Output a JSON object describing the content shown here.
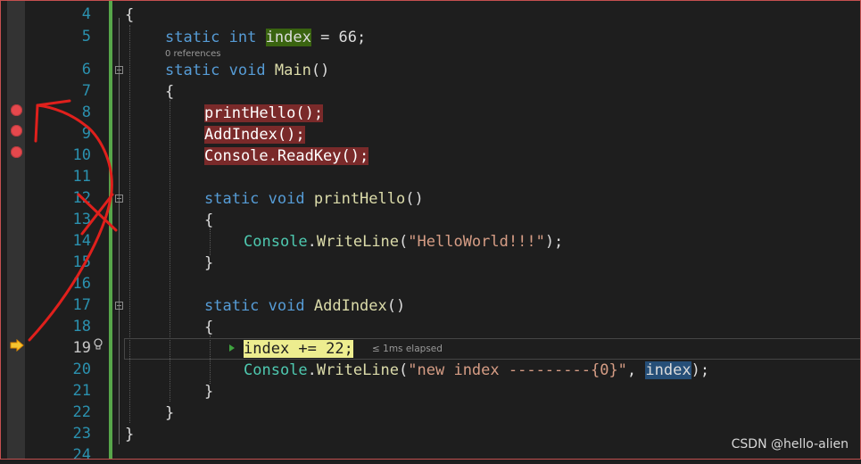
{
  "editor": {
    "line_numbers": [
      "4",
      "5",
      "6",
      "7",
      "8",
      "9",
      "10",
      "11",
      "12",
      "13",
      "14",
      "15",
      "16",
      "17",
      "18",
      "19",
      "20",
      "21",
      "22",
      "23",
      "24"
    ],
    "current_line": "19",
    "breakpoint_lines": [
      "8",
      "9",
      "10"
    ],
    "codelens_references": "0 references",
    "elapsed_tip": "≤ 1ms elapsed",
    "tokens": {
      "open_brace": "{",
      "close_brace": "}",
      "static": "static",
      "int": "int",
      "void": "void",
      "index": "index",
      "eq_66": " = 66;",
      "main_name": "Main",
      "parens": "()",
      "printHello_call": "printHello();",
      "addIndex_call": "AddIndex();",
      "readkey_call": "Console.ReadKey();",
      "printHello_name": "printHello",
      "addIndex_name": "AddIndex",
      "console": "Console",
      "dot": ".",
      "writeline": "WriteLine",
      "open_paren": "(",
      "close_paren_semi": ");",
      "str_hello": "\"HelloWorld!!!\"",
      "str_new_index": "\"new index ---------{0}\"",
      "comma": ", ",
      "index_plus_22": "index += 22;"
    }
  },
  "colors": {
    "keyword": "#569cd6",
    "type": "#4ec9b0",
    "method": "#dcdcaa",
    "string": "#d69d85",
    "number": "#b5cea8",
    "breakpoint": "#e5484d",
    "annotation": "#e0201c"
  },
  "icons": {
    "breakpoint": "breakpoint-icon",
    "current_statement": "current-statement-arrow-icon",
    "quick_actions": "lightbulb-icon",
    "run_to_click": "run-to-click-icon",
    "fold": "collapse-region-icon"
  },
  "watermark": "CSDN @hello-alien"
}
